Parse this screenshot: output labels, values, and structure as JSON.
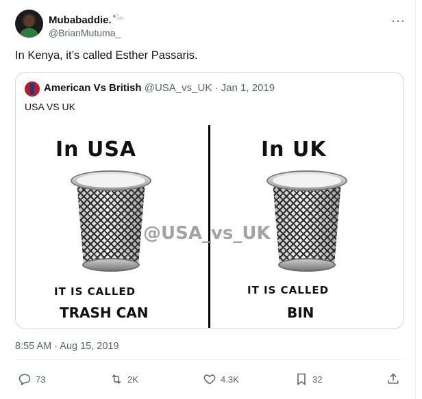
{
  "tweet": {
    "display_name": "Mubabaddie.",
    "badge": "⁶🦢",
    "handle": "@BrianMutuma_",
    "more_icon": "more-dots-icon",
    "text": "In Kenya, it’s called Esther Passaris.",
    "timestamp": "8:55 AM · Aug 15, 2019"
  },
  "quote": {
    "display_name": "American Vs British",
    "handle": "@USA_vs_UK",
    "date": "· Jan 1, 2019",
    "text": "USA VS UK",
    "image": {
      "left_heading": "In USA",
      "right_heading": "In UK",
      "left_caption": "IT IS CALLED",
      "right_caption": "IT IS CALLED",
      "left_word": "TRASH CAN",
      "right_word": "BIN",
      "watermark": "@USA_vs_UK"
    }
  },
  "actions": {
    "replies": "73",
    "retweets": "2K",
    "likes": "4.3K",
    "bookmarks": "32"
  },
  "colors": {
    "text": "#0f1419",
    "muted": "#536471",
    "border": "#cfd9de"
  }
}
